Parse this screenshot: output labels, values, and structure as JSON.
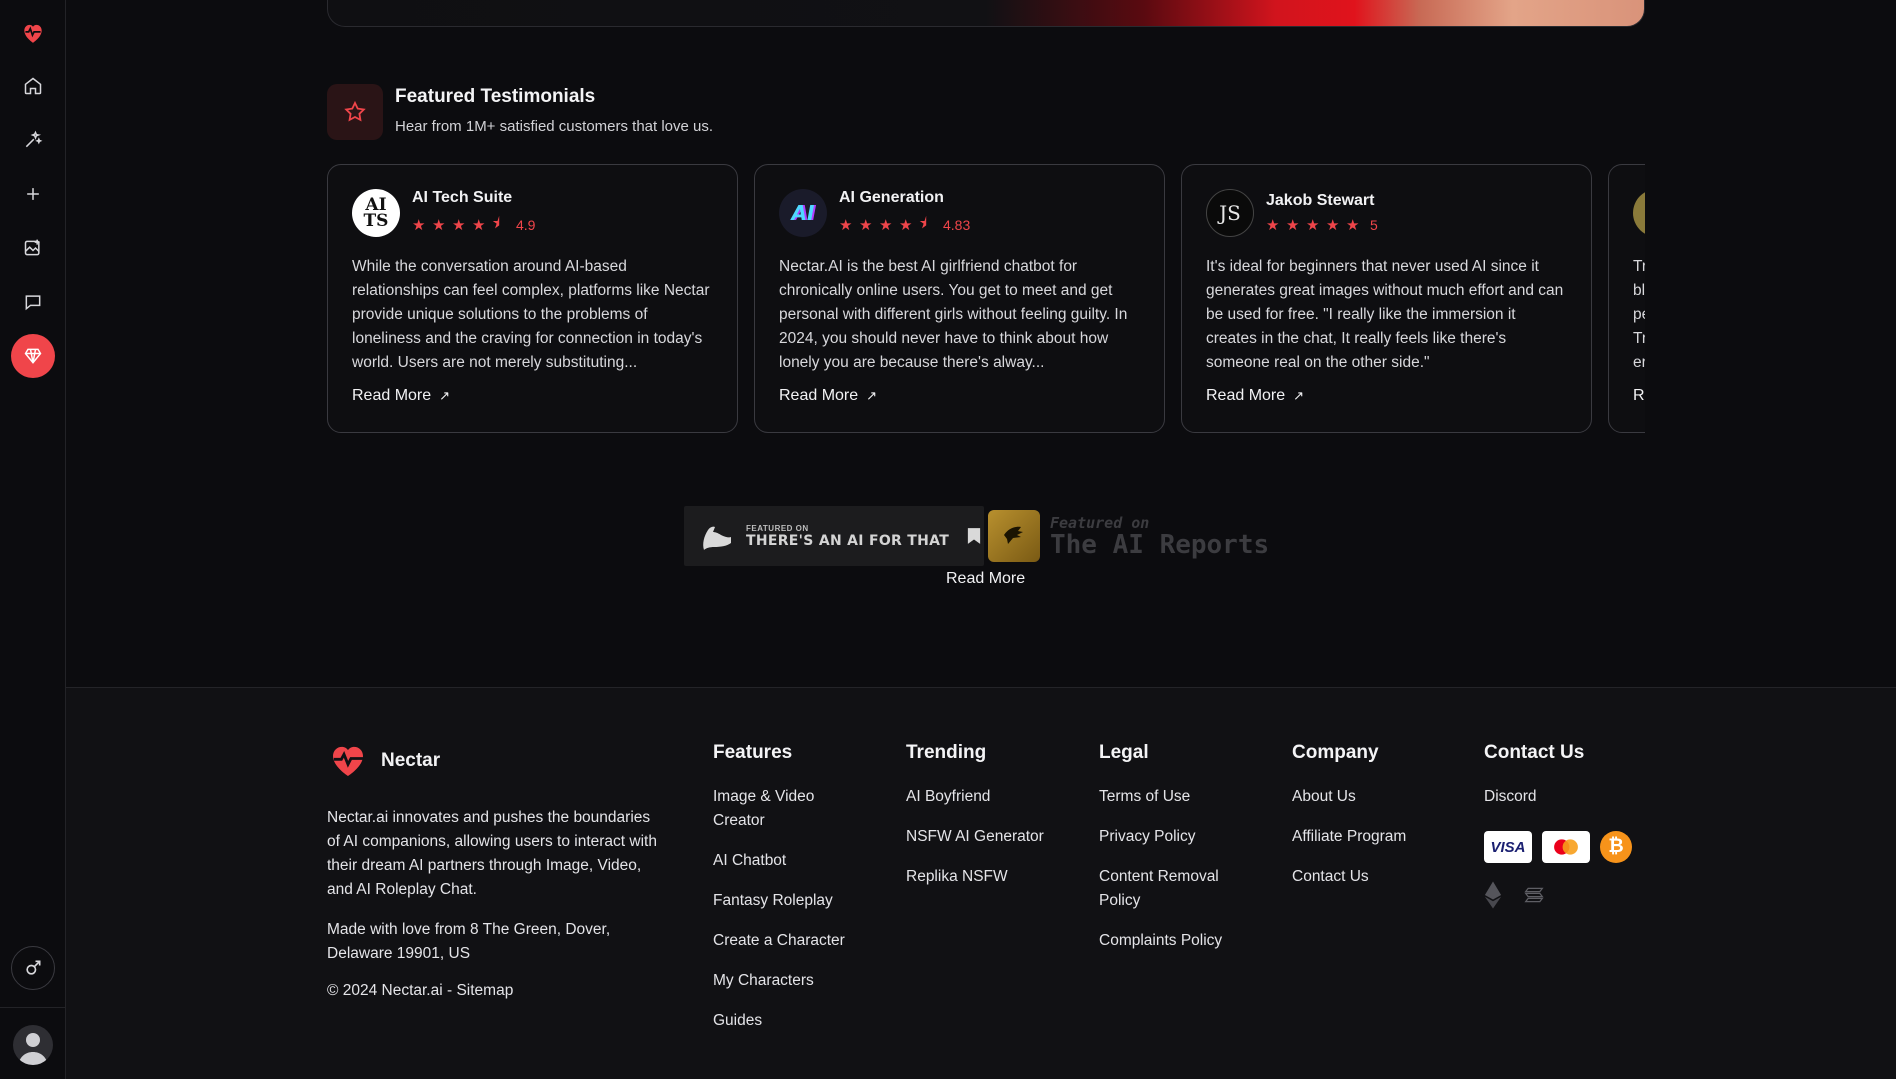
{
  "testimonials": {
    "title": "Featured Testimonials",
    "subtitle": "Hear from 1M+ satisfied customers that love us.",
    "read_more_label": "Read More",
    "cards": [
      {
        "name": "AI Tech Suite",
        "logo_text": "AI TS",
        "rating": "4.9",
        "stars": 4.5,
        "text": "While the conversation around AI-based relationships can feel complex, platforms like Nectar provide unique solutions to the problems of loneliness and the craving for connection in today's world. Users are not merely substituting..."
      },
      {
        "name": "AI Generation",
        "logo_text": "AI",
        "rating": "4.83",
        "stars": 4.5,
        "text": "Nectar.AI is the best AI girlfriend chatbot for chronically online users. You get to meet and get personal with different girls without feeling guilty. In 2024, you should never have to think about how lonely you are because there's alway..."
      },
      {
        "name": "Jakob Stewart",
        "logo_text": "JS",
        "rating": "5",
        "stars": 5,
        "text": "It's ideal for beginners that never used AI since it generates great images without much effort and can be used for free. \"I really like the immersion it creates in the chat, It really feels like there's someone real on the other side.\""
      },
      {
        "name": "",
        "logo_text": "",
        "rating": "",
        "stars": 0,
        "text": "Tr bl pe Tr er"
      }
    ]
  },
  "featured": {
    "taaft_small": "FEATURED ON",
    "taaft_big": "THERE'S AN AI FOR THAT",
    "air_small": "Featured on",
    "air_big": "The AI Reports",
    "read_more": "Read More"
  },
  "footer": {
    "brand": "Nectar",
    "description": "Nectar.ai innovates and pushes the boundaries of AI companions, allowing users to interact with their dream AI partners through Image, Video, and AI Roleplay Chat.",
    "address": "Made with love from 8 The Green, Dover, Delaware 19901, US",
    "copyright": "© 2024 Nectar.ai - Sitemap",
    "columns": [
      {
        "title": "Features",
        "links": [
          "Image & Video Creator",
          "AI Chatbot",
          "Fantasy Roleplay",
          "Create a Character",
          "My Characters",
          "Guides"
        ]
      },
      {
        "title": "Trending",
        "links": [
          "AI Boyfriend",
          "NSFW AI Generator",
          "Replika NSFW"
        ]
      },
      {
        "title": "Legal",
        "links": [
          "Terms of Use",
          "Privacy Policy",
          "Content Removal Policy",
          "Complaints Policy"
        ]
      },
      {
        "title": "Company",
        "links": [
          "About Us",
          "Affiliate Program",
          "Contact Us"
        ]
      },
      {
        "title": "Contact Us",
        "links": [
          "Discord"
        ]
      }
    ],
    "payments": [
      "visa-icon",
      "mastercard-icon",
      "bitcoin-icon",
      "ethereum-icon",
      "solana-icon"
    ],
    "payment_text": {
      "visa": "VISA",
      "btc": "₿"
    }
  },
  "sidebar": {
    "icons": [
      "heart-logo-icon",
      "home-icon",
      "sparkle-wand-icon",
      "plus-icon",
      "image-edit-icon",
      "chat-icon",
      "premium-gem-icon",
      "gender-male-icon",
      "user-avatar"
    ]
  },
  "colors": {
    "accent": "#f0454a",
    "background": "#0c0c0f",
    "footer": "#111114"
  }
}
